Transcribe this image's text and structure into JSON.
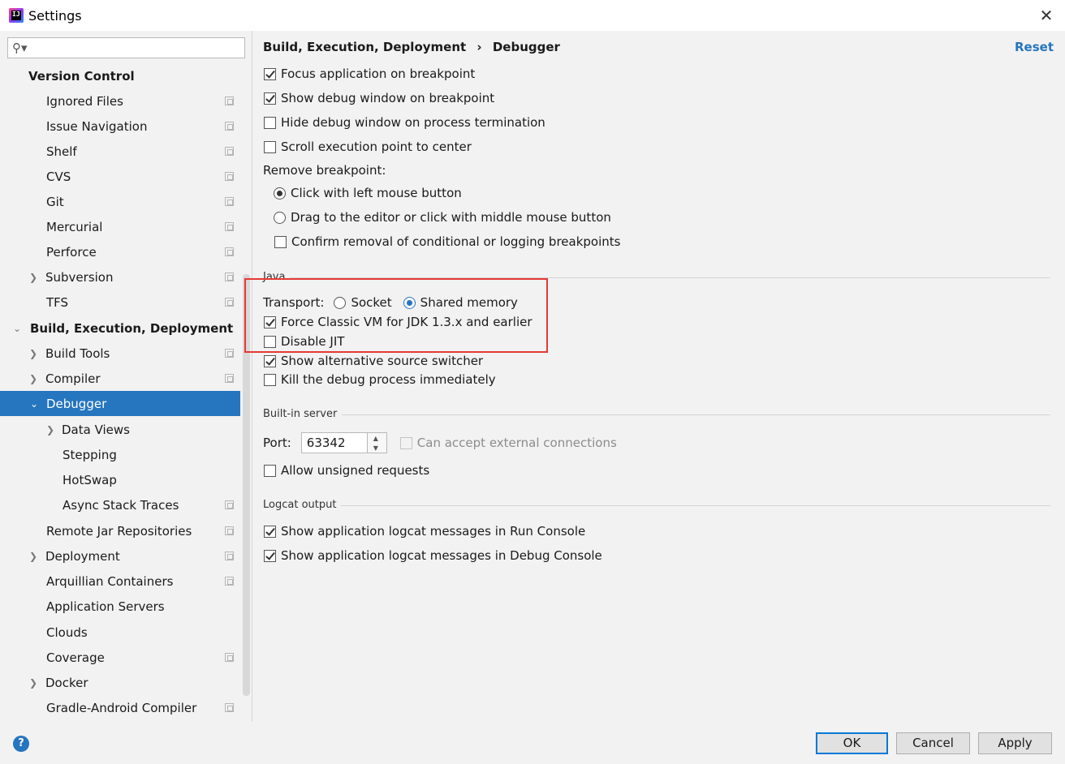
{
  "window": {
    "title": "Settings"
  },
  "sidebar": {
    "items": [
      {
        "label": "Version Control",
        "bold": true
      },
      {
        "label": "Ignored Files"
      },
      {
        "label": "Issue Navigation"
      },
      {
        "label": "Shelf"
      },
      {
        "label": "CVS"
      },
      {
        "label": "Git"
      },
      {
        "label": "Mercurial"
      },
      {
        "label": "Perforce"
      },
      {
        "label": "Subversion"
      },
      {
        "label": "TFS"
      },
      {
        "label": "Build, Execution, Deployment",
        "bold": true
      },
      {
        "label": "Build Tools"
      },
      {
        "label": "Compiler"
      },
      {
        "label": "Debugger",
        "selected": true
      },
      {
        "label": "Data Views"
      },
      {
        "label": "Stepping"
      },
      {
        "label": "HotSwap"
      },
      {
        "label": "Async Stack Traces"
      },
      {
        "label": "Remote Jar Repositories"
      },
      {
        "label": "Deployment"
      },
      {
        "label": "Arquillian Containers"
      },
      {
        "label": "Application Servers"
      },
      {
        "label": "Clouds"
      },
      {
        "label": "Coverage"
      },
      {
        "label": "Docker"
      },
      {
        "label": "Gradle-Android Compiler"
      }
    ]
  },
  "main": {
    "breadcrumb": {
      "parent": "Build, Execution, Deployment",
      "separator": "›",
      "current": "Debugger"
    },
    "reset_label": "Reset",
    "general": {
      "focus_app": {
        "label": "Focus application on breakpoint",
        "checked": true
      },
      "show_debug_window": {
        "label": "Show debug window on breakpoint",
        "checked": true
      },
      "hide_debug_window": {
        "label": "Hide debug window on process termination",
        "checked": false
      },
      "scroll_exec_point": {
        "label": "Scroll execution point to center",
        "checked": false
      }
    },
    "remove_breakpoint": {
      "label": "Remove breakpoint:",
      "left_click": {
        "label": "Click with left mouse button",
        "checked": true
      },
      "drag_middle": {
        "label": "Drag to the editor or click with middle mouse button",
        "checked": false
      },
      "confirm_removal": {
        "label": "Confirm removal of conditional or logging breakpoints",
        "checked": false
      }
    },
    "java": {
      "section": "Java",
      "transport_label": "Transport:",
      "socket": {
        "label": "Socket",
        "checked": false
      },
      "shared_memory": {
        "label": "Shared memory",
        "checked": true
      },
      "force_classic_vm": {
        "label": "Force Classic VM for JDK 1.3.x and earlier",
        "checked": true
      },
      "disable_jit": {
        "label": "Disable JIT",
        "checked": false
      },
      "alt_source_switcher": {
        "label": "Show alternative source switcher",
        "checked": true
      },
      "kill_immediately": {
        "label": "Kill the debug process immediately",
        "checked": false
      }
    },
    "builtin_server": {
      "section": "Built-in server",
      "port_label": "Port:",
      "port_value": "63342",
      "external_connections": {
        "label": "Can accept external connections",
        "checked": false
      },
      "unsigned_requests": {
        "label": "Allow unsigned requests",
        "checked": false
      }
    },
    "logcat": {
      "section": "Logcat output",
      "run_console": {
        "label": "Show application logcat messages in Run Console",
        "checked": true
      },
      "debug_console": {
        "label": "Show application logcat messages in Debug Console",
        "checked": true
      }
    }
  },
  "footer": {
    "help": "?",
    "ok_label": "OK",
    "cancel_label": "Cancel",
    "apply_label": "Apply"
  },
  "colors": {
    "accent": "#2675bf",
    "highlight_box": "#e53935"
  }
}
